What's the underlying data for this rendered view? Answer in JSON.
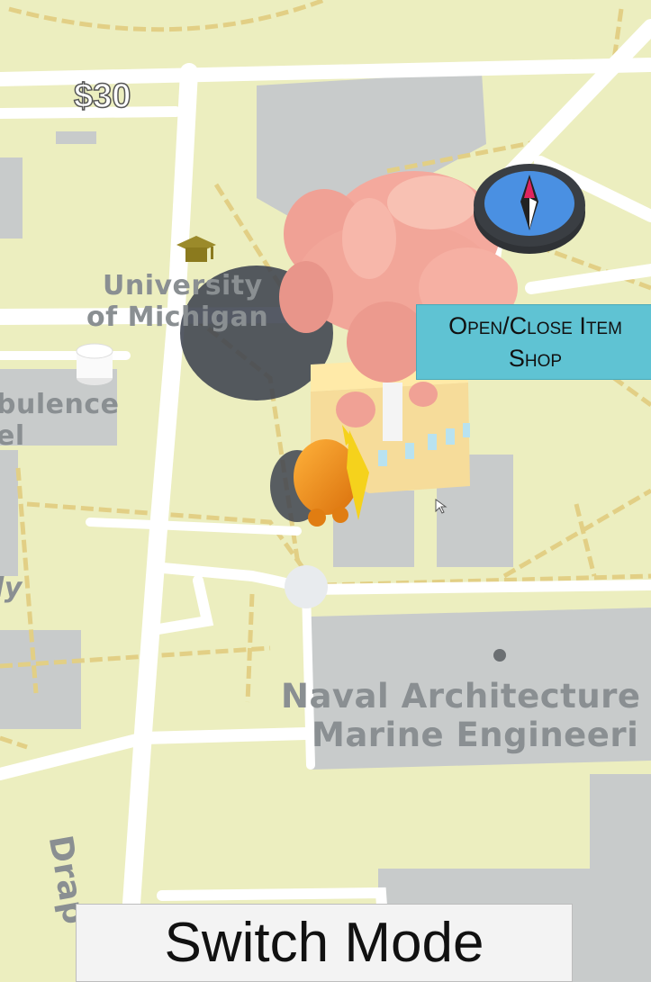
{
  "hud": {
    "money": "$30",
    "shop_button_line1": "Open/Close Item",
    "shop_button_line2": "Shop",
    "switch_mode_button": "Switch Mode",
    "compass_icon": "compass-icon"
  },
  "map": {
    "labels": {
      "university_line1": "University",
      "university_line2": "of Michigan",
      "turbulence_line1": "bulence",
      "turbulence_line2": "el",
      "partial_ly": "ly",
      "naval_line1": "Naval Architecture",
      "naval_line2": "Marine Engineeri",
      "street": "Drap"
    },
    "icons": [
      "graduation-cap-icon",
      "cylinder-landmark",
      "tree-landmark",
      "building-landmark",
      "creature-character"
    ]
  },
  "colors": {
    "land": "#eceebf",
    "road": "#ffffff",
    "building": "#c6c9c9",
    "path": "#ead98f",
    "tree_pink": "#f1a79a",
    "shop_button": "#5fc3d3",
    "creature": "#f29a1c"
  }
}
